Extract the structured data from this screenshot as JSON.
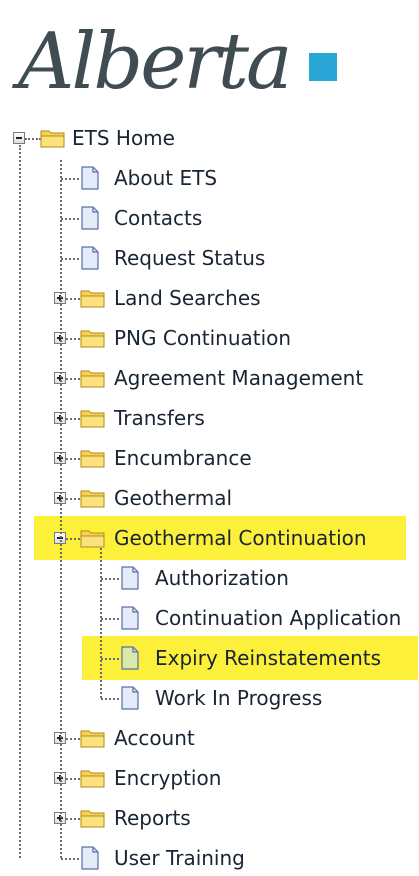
{
  "logo": {
    "text": "Alberta",
    "accent_color": "#2aa6d6",
    "ink_color": "#3f4c52"
  },
  "tree": {
    "root": {
      "label": "ETS Home",
      "expanded": true,
      "icon": "folder-icon"
    },
    "items": [
      {
        "label": "About ETS",
        "type": "page",
        "icon": "page-icon"
      },
      {
        "label": "Contacts",
        "type": "page",
        "icon": "page-icon"
      },
      {
        "label": "Request Status",
        "type": "page",
        "icon": "page-icon"
      },
      {
        "label": "Land Searches",
        "type": "folder",
        "expanded": false,
        "icon": "folder-icon"
      },
      {
        "label": "PNG Continuation",
        "type": "folder",
        "expanded": false,
        "icon": "folder-icon"
      },
      {
        "label": "Agreement Management",
        "type": "folder",
        "expanded": false,
        "icon": "folder-icon"
      },
      {
        "label": "Transfers",
        "type": "folder",
        "expanded": false,
        "icon": "folder-icon"
      },
      {
        "label": "Encumbrance",
        "type": "folder",
        "expanded": false,
        "icon": "folder-icon"
      },
      {
        "label": "Geothermal",
        "type": "folder",
        "expanded": false,
        "icon": "folder-icon"
      },
      {
        "label": "Geothermal Continuation",
        "type": "folder",
        "expanded": true,
        "highlighted": true,
        "icon": "folder-icon",
        "children": [
          {
            "label": "Authorization",
            "type": "page",
            "icon": "page-icon"
          },
          {
            "label": "Continuation Application",
            "type": "page",
            "icon": "page-icon"
          },
          {
            "label": "Expiry Reinstatements",
            "type": "page",
            "highlighted": true,
            "icon": "page-icon"
          },
          {
            "label": "Work In Progress",
            "type": "page",
            "icon": "page-icon"
          }
        ]
      },
      {
        "label": "Account",
        "type": "folder",
        "expanded": false,
        "icon": "folder-icon"
      },
      {
        "label": "Encryption",
        "type": "folder",
        "expanded": false,
        "icon": "folder-icon"
      },
      {
        "label": "Reports",
        "type": "folder",
        "expanded": false,
        "icon": "folder-icon"
      },
      {
        "label": "User Training",
        "type": "page",
        "icon": "page-icon"
      }
    ]
  },
  "colors": {
    "highlight": "#fcf03a",
    "folder": "#f7d35a",
    "page": "#e3ebf8",
    "page_highlighted": "#d9e9a8"
  }
}
